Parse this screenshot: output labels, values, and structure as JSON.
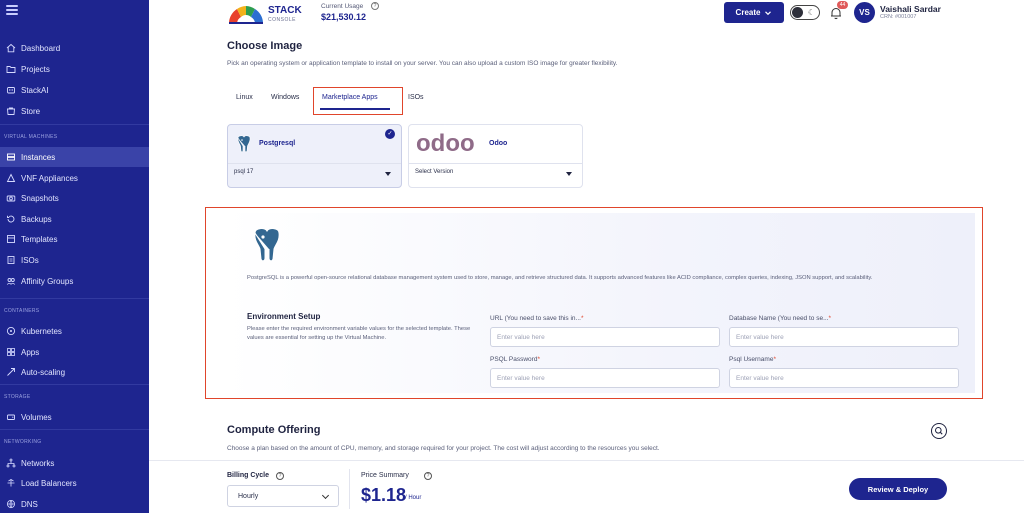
{
  "sidebar": {
    "items": [
      {
        "label": "Dashboard",
        "icon": "home-icon"
      },
      {
        "label": "Projects",
        "icon": "folder-icon"
      },
      {
        "label": "StackAI",
        "icon": "ai-icon"
      },
      {
        "label": "Store",
        "icon": "store-icon"
      },
      {
        "label": "Instances",
        "icon": "server-icon",
        "active": true
      },
      {
        "label": "VNF Appliances",
        "icon": "appliance-icon"
      },
      {
        "label": "Snapshots",
        "icon": "camera-icon"
      },
      {
        "label": "Backups",
        "icon": "backup-icon"
      },
      {
        "label": "Templates",
        "icon": "template-icon"
      },
      {
        "label": "ISOs",
        "icon": "disc-icon"
      },
      {
        "label": "Affinity Groups",
        "icon": "group-icon"
      },
      {
        "label": "Kubernetes",
        "icon": "kubernetes-icon"
      },
      {
        "label": "Apps",
        "icon": "apps-icon"
      },
      {
        "label": "Auto-scaling",
        "icon": "scaling-icon"
      },
      {
        "label": "Volumes",
        "icon": "volume-icon"
      },
      {
        "label": "Networks",
        "icon": "network-icon"
      },
      {
        "label": "Load Balancers",
        "icon": "balancer-icon"
      },
      {
        "label": "DNS",
        "icon": "globe-icon"
      }
    ],
    "sections": [
      "VIRTUAL MACHINES",
      "CONTAINERS",
      "STORAGE",
      "NETWORKING"
    ]
  },
  "header": {
    "logo_text": "STACK",
    "logo_sub": "CONSOLE",
    "usage_label": "Current Usage",
    "usage_value": "$21,530.12",
    "create_label": "Create",
    "notification_count": "44",
    "avatar_initials": "VS",
    "user_name": "Vaishali Sardar",
    "user_crn": "CRN: #001007"
  },
  "choose_image": {
    "title": "Choose Image",
    "subtitle": "Pick an operating system or application template to install on your server. You can also upload a custom ISO image for greater flexibility.",
    "tabs": [
      "Linux",
      "Windows",
      "Marketplace Apps",
      "ISOs"
    ],
    "active_tab": "Marketplace Apps",
    "cards": [
      {
        "name": "Postgresql",
        "version": "psql 17",
        "selected": true
      },
      {
        "name": "Odoo",
        "logo_text": "odoo",
        "version": "Select Version",
        "selected": false
      }
    ]
  },
  "app_detail": {
    "description": "PostgreSQL is a powerful open-source relational database management system used to store, manage, and retrieve structured data. It supports advanced features like ACID compliance, complex queries, indexing, JSON support, and scalability.",
    "env_title": "Environment Setup",
    "env_subtitle": "Please enter the required environment variable values for the selected template. These values are essential for setting up the Virtual Machine.",
    "fields": [
      {
        "label": "URL (You need to save this in...",
        "placeholder": "Enter value here"
      },
      {
        "label": "Database Name (You need to se...",
        "placeholder": "Enter value here"
      },
      {
        "label": "PSQL Password",
        "placeholder": "Enter value here"
      },
      {
        "label": "Psql Username",
        "placeholder": "Enter value here"
      }
    ]
  },
  "compute": {
    "title": "Compute Offering",
    "subtitle": "Choose a plan based on the amount of CPU, memory, and storage required for your project. The cost will adjust according to the resources you select."
  },
  "footer": {
    "billing_label": "Billing Cycle",
    "billing_value": "Hourly",
    "price_label": "Price Summary",
    "price_value": "$1.18",
    "price_unit": "/ Hour",
    "deploy_label": "Review & Deploy"
  },
  "colors": {
    "brand": "#1e258f",
    "highlight": "#e0452b"
  }
}
